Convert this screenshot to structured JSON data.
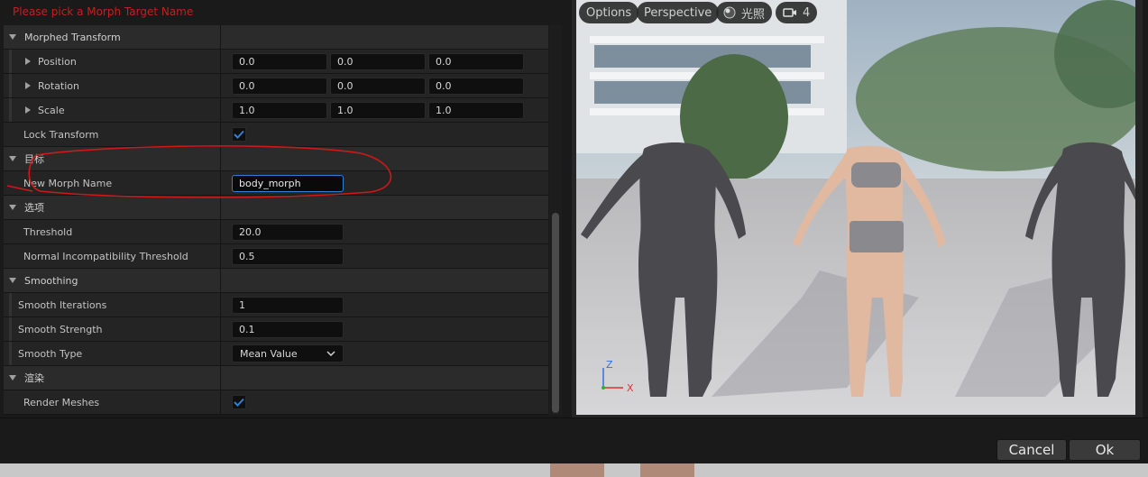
{
  "warning": "Please pick a Morph Target Name",
  "details": {
    "morphed_transform": {
      "label": "Morphed Transform",
      "position": {
        "label": "Position",
        "x": "0.0",
        "y": "0.0",
        "z": "0.0"
      },
      "rotation": {
        "label": "Rotation",
        "x": "0.0",
        "y": "0.0",
        "z": "0.0"
      },
      "scale": {
        "label": "Scale",
        "x": "1.0",
        "y": "1.0",
        "z": "1.0"
      }
    },
    "lock_transform": {
      "label": "Lock Transform",
      "checked": true
    },
    "target": {
      "label": "目标",
      "new_morph_name": {
        "label": "New Morph Name",
        "value": "body_morph"
      }
    },
    "options": {
      "label": "选项",
      "threshold": {
        "label": "Threshold",
        "value": "20.0"
      },
      "normal_threshold": {
        "label": "Normal Incompatibility Threshold",
        "value": "0.5"
      }
    },
    "smoothing": {
      "label": "Smoothing",
      "iterations": {
        "label": "Smooth Iterations",
        "value": "1"
      },
      "strength": {
        "label": "Smooth Strength",
        "value": "0.1"
      },
      "type": {
        "label": "Smooth Type",
        "value": "Mean Value"
      }
    },
    "render": {
      "label": "渲染",
      "render_meshes": {
        "label": "Render Meshes",
        "checked": true
      }
    }
  },
  "viewport": {
    "options_label": "Options",
    "perspective_label": "Perspective",
    "lighting_label": "光照",
    "camera_speed": "4",
    "axis_x": "X",
    "axis_z": "Z"
  },
  "footer": {
    "cancel_label": "Cancel",
    "ok_label": "Ok"
  },
  "colors": {
    "accent": "#2f7fd6",
    "warning": "#c42020",
    "panel": "#242424"
  }
}
